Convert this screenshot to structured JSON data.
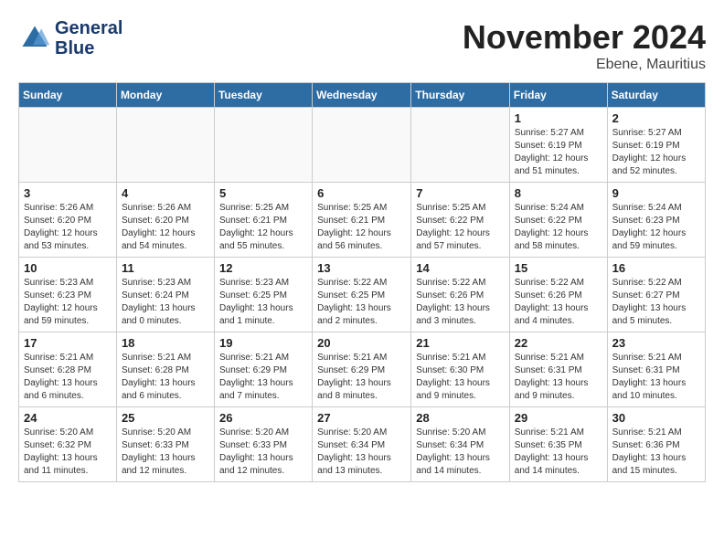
{
  "header": {
    "logo_line1": "General",
    "logo_line2": "Blue",
    "month": "November 2024",
    "location": "Ebene, Mauritius"
  },
  "weekdays": [
    "Sunday",
    "Monday",
    "Tuesday",
    "Wednesday",
    "Thursday",
    "Friday",
    "Saturday"
  ],
  "weeks": [
    [
      {
        "day": "",
        "info": ""
      },
      {
        "day": "",
        "info": ""
      },
      {
        "day": "",
        "info": ""
      },
      {
        "day": "",
        "info": ""
      },
      {
        "day": "",
        "info": ""
      },
      {
        "day": "1",
        "info": "Sunrise: 5:27 AM\nSunset: 6:19 PM\nDaylight: 12 hours\nand 51 minutes."
      },
      {
        "day": "2",
        "info": "Sunrise: 5:27 AM\nSunset: 6:19 PM\nDaylight: 12 hours\nand 52 minutes."
      }
    ],
    [
      {
        "day": "3",
        "info": "Sunrise: 5:26 AM\nSunset: 6:20 PM\nDaylight: 12 hours\nand 53 minutes."
      },
      {
        "day": "4",
        "info": "Sunrise: 5:26 AM\nSunset: 6:20 PM\nDaylight: 12 hours\nand 54 minutes."
      },
      {
        "day": "5",
        "info": "Sunrise: 5:25 AM\nSunset: 6:21 PM\nDaylight: 12 hours\nand 55 minutes."
      },
      {
        "day": "6",
        "info": "Sunrise: 5:25 AM\nSunset: 6:21 PM\nDaylight: 12 hours\nand 56 minutes."
      },
      {
        "day": "7",
        "info": "Sunrise: 5:25 AM\nSunset: 6:22 PM\nDaylight: 12 hours\nand 57 minutes."
      },
      {
        "day": "8",
        "info": "Sunrise: 5:24 AM\nSunset: 6:22 PM\nDaylight: 12 hours\nand 58 minutes."
      },
      {
        "day": "9",
        "info": "Sunrise: 5:24 AM\nSunset: 6:23 PM\nDaylight: 12 hours\nand 59 minutes."
      }
    ],
    [
      {
        "day": "10",
        "info": "Sunrise: 5:23 AM\nSunset: 6:23 PM\nDaylight: 12 hours\nand 59 minutes."
      },
      {
        "day": "11",
        "info": "Sunrise: 5:23 AM\nSunset: 6:24 PM\nDaylight: 13 hours\nand 0 minutes."
      },
      {
        "day": "12",
        "info": "Sunrise: 5:23 AM\nSunset: 6:25 PM\nDaylight: 13 hours\nand 1 minute."
      },
      {
        "day": "13",
        "info": "Sunrise: 5:22 AM\nSunset: 6:25 PM\nDaylight: 13 hours\nand 2 minutes."
      },
      {
        "day": "14",
        "info": "Sunrise: 5:22 AM\nSunset: 6:26 PM\nDaylight: 13 hours\nand 3 minutes."
      },
      {
        "day": "15",
        "info": "Sunrise: 5:22 AM\nSunset: 6:26 PM\nDaylight: 13 hours\nand 4 minutes."
      },
      {
        "day": "16",
        "info": "Sunrise: 5:22 AM\nSunset: 6:27 PM\nDaylight: 13 hours\nand 5 minutes."
      }
    ],
    [
      {
        "day": "17",
        "info": "Sunrise: 5:21 AM\nSunset: 6:28 PM\nDaylight: 13 hours\nand 6 minutes."
      },
      {
        "day": "18",
        "info": "Sunrise: 5:21 AM\nSunset: 6:28 PM\nDaylight: 13 hours\nand 6 minutes."
      },
      {
        "day": "19",
        "info": "Sunrise: 5:21 AM\nSunset: 6:29 PM\nDaylight: 13 hours\nand 7 minutes."
      },
      {
        "day": "20",
        "info": "Sunrise: 5:21 AM\nSunset: 6:29 PM\nDaylight: 13 hours\nand 8 minutes."
      },
      {
        "day": "21",
        "info": "Sunrise: 5:21 AM\nSunset: 6:30 PM\nDaylight: 13 hours\nand 9 minutes."
      },
      {
        "day": "22",
        "info": "Sunrise: 5:21 AM\nSunset: 6:31 PM\nDaylight: 13 hours\nand 9 minutes."
      },
      {
        "day": "23",
        "info": "Sunrise: 5:21 AM\nSunset: 6:31 PM\nDaylight: 13 hours\nand 10 minutes."
      }
    ],
    [
      {
        "day": "24",
        "info": "Sunrise: 5:20 AM\nSunset: 6:32 PM\nDaylight: 13 hours\nand 11 minutes."
      },
      {
        "day": "25",
        "info": "Sunrise: 5:20 AM\nSunset: 6:33 PM\nDaylight: 13 hours\nand 12 minutes."
      },
      {
        "day": "26",
        "info": "Sunrise: 5:20 AM\nSunset: 6:33 PM\nDaylight: 13 hours\nand 12 minutes."
      },
      {
        "day": "27",
        "info": "Sunrise: 5:20 AM\nSunset: 6:34 PM\nDaylight: 13 hours\nand 13 minutes."
      },
      {
        "day": "28",
        "info": "Sunrise: 5:20 AM\nSunset: 6:34 PM\nDaylight: 13 hours\nand 14 minutes."
      },
      {
        "day": "29",
        "info": "Sunrise: 5:21 AM\nSunset: 6:35 PM\nDaylight: 13 hours\nand 14 minutes."
      },
      {
        "day": "30",
        "info": "Sunrise: 5:21 AM\nSunset: 6:36 PM\nDaylight: 13 hours\nand 15 minutes."
      }
    ]
  ]
}
